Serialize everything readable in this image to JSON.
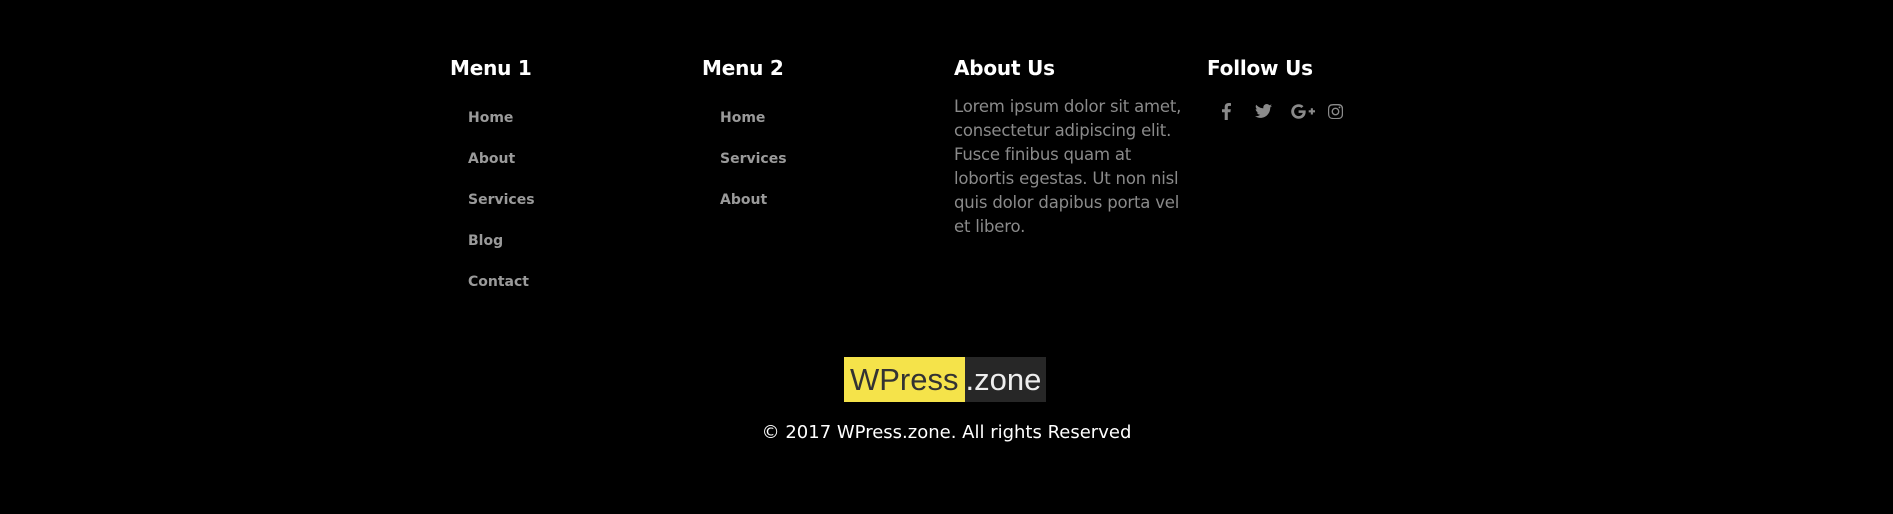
{
  "footer": {
    "menu1": {
      "title": "Menu 1",
      "items": [
        {
          "label": "Home"
        },
        {
          "label": "About"
        },
        {
          "label": "Services"
        },
        {
          "label": "Blog"
        },
        {
          "label": "Contact"
        }
      ]
    },
    "menu2": {
      "title": "Menu 2",
      "items": [
        {
          "label": "Home"
        },
        {
          "label": "Services"
        },
        {
          "label": "About"
        }
      ]
    },
    "about": {
      "title": "About Us",
      "text": "Lorem ipsum dolor sit amet, consectetur adipiscing elit. Fusce finibus quam at lobortis egestas. Ut non nisl quis dolor dapibus porta vel et libero."
    },
    "follow": {
      "title": "Follow Us",
      "icons": [
        "facebook-icon",
        "twitter-icon",
        "google-plus-icon",
        "instagram-icon"
      ]
    }
  },
  "logo": {
    "main": "WPress",
    "ext": ".zone",
    "accent_color": "#f5e34a",
    "dark_color": "#272727"
  },
  "copyright": "© 2017 WPress.zone. All rights Reserved",
  "colors": {
    "background": "#000000",
    "link": "#9a9a9a",
    "body_text": "#8a8a8a",
    "heading": "#ffffff"
  }
}
